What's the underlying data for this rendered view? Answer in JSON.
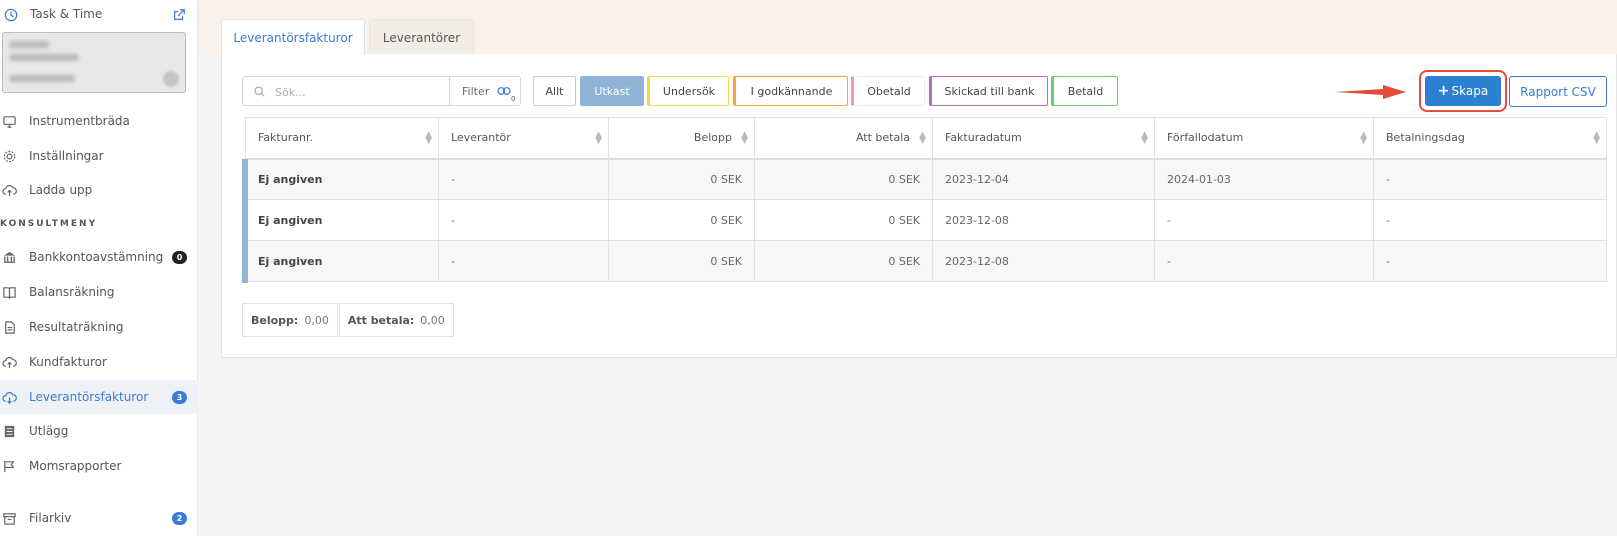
{
  "sidebar": {
    "header_title": "Task & Time",
    "section_label": "KONSULTMENY",
    "items": [
      {
        "label": "Instrumentbräda"
      },
      {
        "label": "Inställningar"
      },
      {
        "label": "Ladda upp"
      },
      {
        "label": "Bankkontoavstämning",
        "badge": "0"
      },
      {
        "label": "Balansräkning"
      },
      {
        "label": "Resultaträkning"
      },
      {
        "label": "Kundfakturor"
      },
      {
        "label": "Leverantörsfakturor",
        "badge": "3"
      },
      {
        "label": "Utlägg"
      },
      {
        "label": "Momsrapporter"
      },
      {
        "label": "Filarkiv",
        "badge": "2"
      }
    ]
  },
  "tabs": [
    "Leverantörsfakturor",
    "Leverantörer"
  ],
  "search": {
    "placeholder": "Sök..."
  },
  "filter": {
    "label": "Filter",
    "count": "0"
  },
  "status_filters": [
    {
      "label": "Allt",
      "color": "#aaaaaa"
    },
    {
      "label": "Utkast",
      "color": "#8fb4d8"
    },
    {
      "label": "Undersök",
      "color": "#f2d94a"
    },
    {
      "label": "I godkännande",
      "color": "#f0a843"
    },
    {
      "label": "Obetald",
      "color": "#f19aa3"
    },
    {
      "label": "Skickad till bank",
      "color": "#b66bc4"
    },
    {
      "label": "Betald",
      "color": "#6ccf6c"
    }
  ],
  "actions": {
    "create_label": "Skapa",
    "csv_label": "Rapport CSV"
  },
  "table": {
    "columns": [
      "Fakturanr.",
      "Leverantör",
      "Belopp",
      "Att betala",
      "Fakturadatum",
      "Förfallodatum",
      "Betalningsdag"
    ],
    "rows": [
      [
        "Ej angiven",
        "-",
        "0 SEK",
        "0 SEK",
        "2023-12-04",
        "2024-01-03",
        "-"
      ],
      [
        "Ej angiven",
        "-",
        "0 SEK",
        "0 SEK",
        "2023-12-08",
        "-",
        "-"
      ],
      [
        "Ej angiven",
        "-",
        "0 SEK",
        "0 SEK",
        "2023-12-08",
        "-",
        "-"
      ]
    ]
  },
  "totals": {
    "belopp_label": "Belopp:",
    "belopp_value": "0,00",
    "att_betala_label": "Att betala:",
    "att_betala_value": "0,00"
  },
  "colors": {
    "accent": "#2d7fd3",
    "annotation": "#e34b3a",
    "draft": "#8fb4d8"
  }
}
